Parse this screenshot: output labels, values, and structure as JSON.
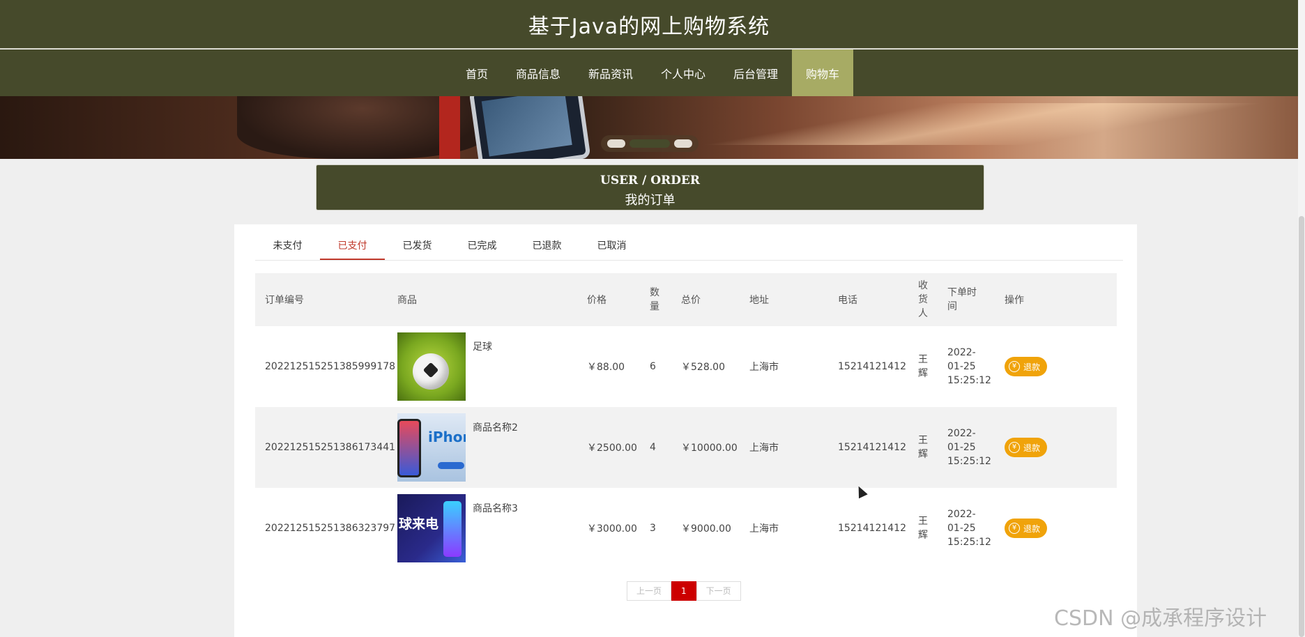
{
  "site": {
    "title": "基于Java的网上购物系统"
  },
  "nav": {
    "items": [
      {
        "label": "首页"
      },
      {
        "label": "商品信息"
      },
      {
        "label": "新品资讯"
      },
      {
        "label": "个人中心"
      },
      {
        "label": "后台管理"
      },
      {
        "label": "购物车",
        "active": true
      }
    ]
  },
  "banner": {
    "slide_index": 2,
    "slide_count": 3
  },
  "section": {
    "title_en": "USER / ORDER",
    "title_zh": "我的订单"
  },
  "tabs": [
    {
      "label": "未支付"
    },
    {
      "label": "已支付",
      "active": true
    },
    {
      "label": "已发货"
    },
    {
      "label": "已完成"
    },
    {
      "label": "已退款"
    },
    {
      "label": "已取消"
    }
  ],
  "table": {
    "headers": {
      "id": "订单编号",
      "goods": "商品",
      "price": "价格",
      "qty_l1": "数",
      "qty_l2": "量",
      "total": "总价",
      "address": "地址",
      "phone": "电话",
      "receiver_l1": "收",
      "receiver_l2": "货",
      "receiver_l3": "人",
      "time_l1": "下单时",
      "time_l2": "间",
      "op": "操作"
    },
    "rows": [
      {
        "id": "20221251525138599917 8",
        "id_full": "202212515251385999178",
        "name": "足球",
        "price": "￥88.00",
        "qty": "6",
        "total": "￥528.00",
        "address": "上海市",
        "phone": "15214121412",
        "receiver_l1": "王",
        "receiver_l2": "辉",
        "date": "2022-",
        "date2": "01-25",
        "time": "15:25:12",
        "action": "退款"
      },
      {
        "id_full": "202212515251386173441",
        "name": "商品名称2",
        "price": "￥2500.00",
        "qty": "4",
        "total": "￥10000.00",
        "address": "上海市",
        "phone": "15214121412",
        "receiver_l1": "王",
        "receiver_l2": "辉",
        "date": "2022-",
        "date2": "01-25",
        "time": "15:25:12",
        "action": "退款"
      },
      {
        "id_full": "202212515251386323797",
        "name": "商品名称3",
        "price": "￥3000.00",
        "qty": "3",
        "total": "￥9000.00",
        "address": "上海市",
        "phone": "15214121412",
        "receiver_l1": "王",
        "receiver_l2": "辉",
        "date": "2022-",
        "date2": "01-25",
        "time": "15:25:12",
        "action": "退款"
      }
    ]
  },
  "thumb_text": {
    "iphone": "iPhon",
    "phone3": "球来电"
  },
  "pager": {
    "prev": "上一页",
    "current": "1",
    "next": "下一页"
  },
  "watermark": "CSDN @成承程序设计",
  "colors": {
    "header_bg": "#464a2b",
    "active_nav": "#a7ab64",
    "active_tab": "#c0392b",
    "refund": "#f0a30a",
    "page_current": "#cc0000"
  }
}
